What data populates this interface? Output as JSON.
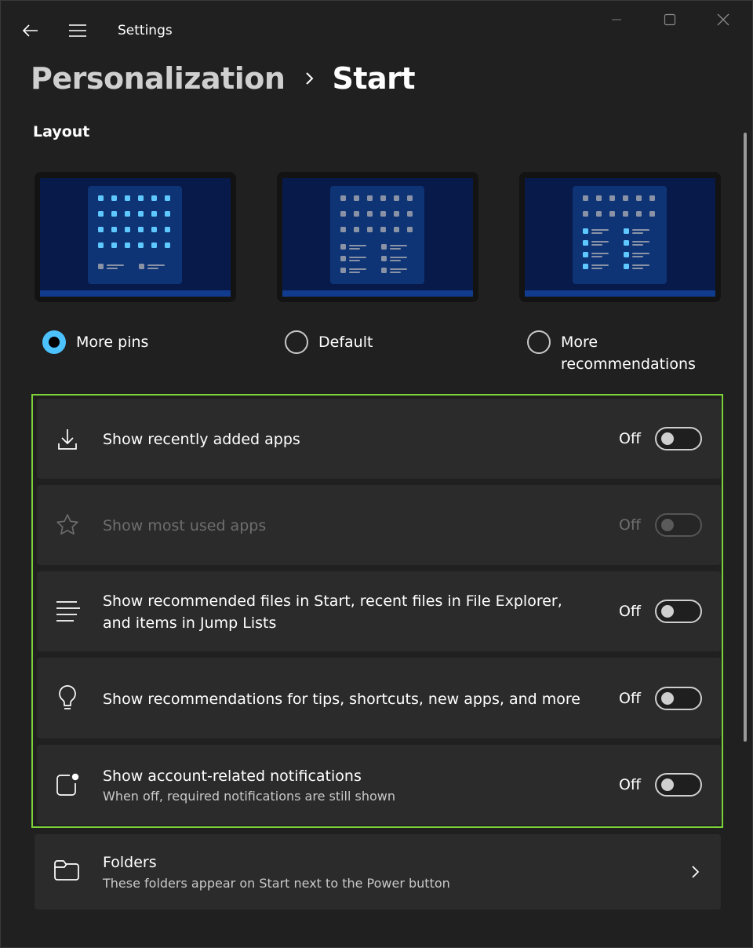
{
  "window": {
    "title": "Settings"
  },
  "breadcrumb": {
    "parent": "Personalization",
    "current": "Start"
  },
  "layout": {
    "section_title": "Layout",
    "options": [
      {
        "label": "More pins",
        "selected": true
      },
      {
        "label": "Default",
        "selected": false
      },
      {
        "label": "More recommendations",
        "selected": false
      }
    ]
  },
  "toggles": [
    {
      "label": "Show recently added apps",
      "state": "Off",
      "icon": "download-icon",
      "enabled": true
    },
    {
      "label": "Show most used apps",
      "state": "Off",
      "icon": "star-icon",
      "enabled": false
    },
    {
      "label": "Show recommended files in Start, recent files in File Explorer, and items in Jump Lists",
      "state": "Off",
      "icon": "list-icon",
      "enabled": true
    },
    {
      "label": "Show recommendations for tips, shortcuts, new apps, and more",
      "state": "Off",
      "icon": "lightbulb-icon",
      "enabled": true
    },
    {
      "label": "Show account-related notifications",
      "sublabel": "When off, required notifications are still shown",
      "state": "Off",
      "icon": "notification-icon",
      "enabled": true
    }
  ],
  "folders": {
    "label": "Folders",
    "sublabel": "These folders appear on Start next to the Power button",
    "icon": "folder-icon"
  },
  "colors": {
    "background": "#202020",
    "card": "#2b2b2b",
    "accent": "#4cc2ff",
    "highlight": "#7bd239"
  }
}
